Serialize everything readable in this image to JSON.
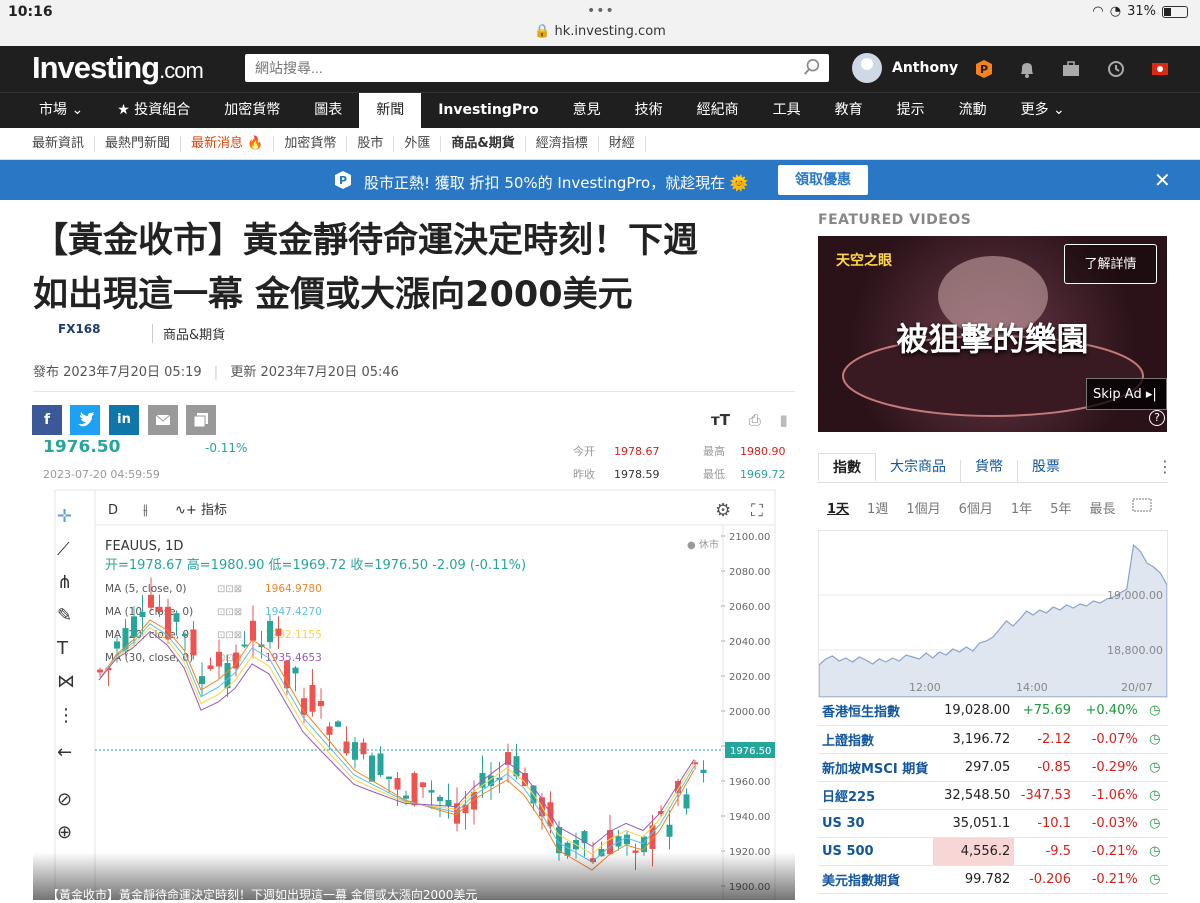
{
  "status": {
    "time": "10:16",
    "dots": "•••",
    "url": "hk.investing.com",
    "battery": "31%"
  },
  "header": {
    "logo_main": "Investing",
    "logo_suffix": ".com",
    "search_placeholder": "網站搜尋...",
    "user": "Anthony"
  },
  "nav": [
    "市場 ⌄",
    "★ 投資組合",
    "加密貨幣",
    "圖表",
    "新聞",
    "InvestingPro",
    "意見",
    "技術",
    "經紀商",
    "工具",
    "教育",
    "提示",
    "流動",
    "更多 ⌄"
  ],
  "nav_active": 4,
  "subnav": [
    "最新資訊",
    "最熱門新聞",
    "最新消息 🔥",
    "加密貨幣",
    "股市",
    "外匯",
    "商品&期貨",
    "經濟指標",
    "財經"
  ],
  "promo": {
    "text": "股市正熱! 獲取 折扣 50%的 InvestingPro，就趁現在 🌞",
    "button": "領取優惠",
    "close": "✕"
  },
  "article": {
    "headline_l1": "【黃金收市】黃金靜待命運決定時刻！下週",
    "headline_l2": "如出現這一幕 金價或大漲向2000美元",
    "source": "FX168",
    "category": "商品&期貨",
    "published": "發布 2023年7月20日 05:19",
    "updated": "更新 2023年7月20日 05:46",
    "font_tool": "ᴛT",
    "caption": "【黃金收市】黃金靜待命運決定時刻！下週如出現這一幕 金價或大漲向2000美元"
  },
  "tv": {
    "price": "1976.50",
    "change": "-0.11%",
    "timestamp": "2023-07-20 04:59:59",
    "open_lbl": "今开",
    "open": "1978.67",
    "high_lbl": "最高",
    "high": "1980.90",
    "prev_lbl": "昨收",
    "prev": "1978.59",
    "low_lbl": "最低",
    "low": "1969.72",
    "interval": "D",
    "indicator": "指标",
    "symbol": "FEAUUS, 1D",
    "rest_label": "● 休市",
    "ohlc": "开=1978.67  高=1980.90  低=1969.72  收=1976.50  -2.09 (-0.11%)",
    "ma": [
      {
        "label": "MA (5, close, 0)",
        "value": "1964.9780",
        "color": "#f5821f"
      },
      {
        "label": "MA (10, close, 0)",
        "value": "1947.4270",
        "color": "#5bc0de"
      },
      {
        "label": "MA (20, close, 0)",
        "value": "1932.1155",
        "color": "#f5d547"
      },
      {
        "label": "MA (30, close, 0)",
        "value": "1935.4653",
        "color": "#9b59b6"
      }
    ],
    "price_tag": "1976.50",
    "y_ticks": [
      "2100.00",
      "2080.00",
      "2060.00",
      "2040.00",
      "2020.00",
      "2000.00",
      "1980.00",
      "1960.00",
      "1940.00",
      "1920.00",
      "1900.00"
    ]
  },
  "sidebar": {
    "featured": "FEATURED VIDEOS",
    "video_title": "被狙擊的樂園",
    "video_logo": "天空之眼",
    "video_learn": "了解詳情",
    "video_skip": "Skip Ad ▸|",
    "video_help": "?",
    "tabs": [
      "指數",
      "大宗商品",
      "貨幣",
      "股票"
    ],
    "ranges": [
      "1天",
      "1週",
      "1個月",
      "6個月",
      "1年",
      "5年",
      "最長"
    ],
    "mini_chart": {
      "y_labels": [
        "19,000.00",
        "18,800.00"
      ],
      "x_labels": [
        "12:00",
        "14:00",
        "20/07"
      ]
    },
    "quotes": [
      {
        "name": "香港恒生指數",
        "last": "19,028.00",
        "chg": "+75.69",
        "pct": "+0.40%",
        "dir": "pos"
      },
      {
        "name": "上證指數",
        "last": "3,196.72",
        "chg": "-2.12",
        "pct": "-0.07%",
        "dir": "neg"
      },
      {
        "name": "新加坡MSCI 期貨",
        "last": "297.05",
        "chg": "-0.85",
        "pct": "-0.29%",
        "dir": "neg"
      },
      {
        "name": "日經225",
        "last": "32,548.50",
        "chg": "-347.53",
        "pct": "-1.06%",
        "dir": "neg"
      },
      {
        "name": "US 30",
        "last": "35,051.1",
        "chg": "-10.1",
        "pct": "-0.03%",
        "dir": "neg"
      },
      {
        "name": "US 500",
        "last": "4,556.2",
        "chg": "-9.5",
        "pct": "-0.21%",
        "dir": "neg",
        "highlight": true
      },
      {
        "name": "美元指數期貨",
        "last": "99.782",
        "chg": "-0.206",
        "pct": "-0.21%",
        "dir": "neg"
      }
    ]
  }
}
